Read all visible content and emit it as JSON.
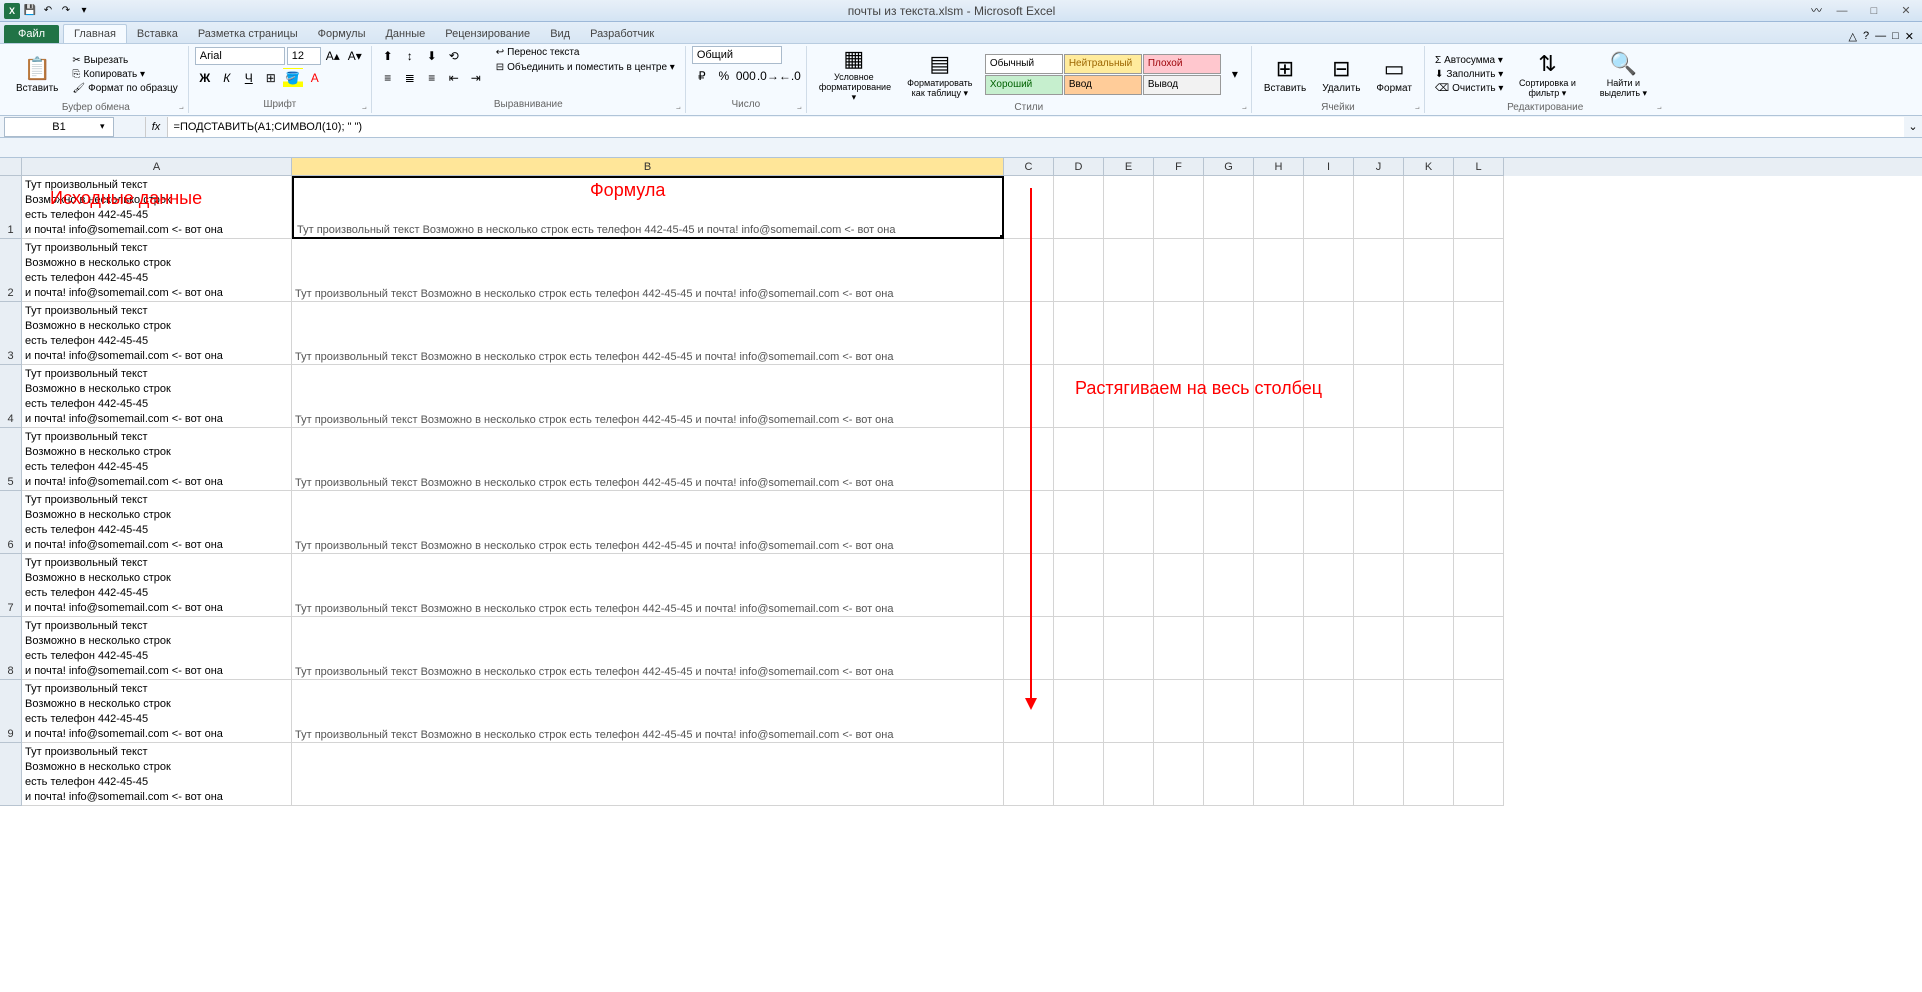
{
  "title": "почты из текста.xlsm - Microsoft Excel",
  "qat": {
    "save": "💾",
    "undo": "↶",
    "redo": "↷"
  },
  "window": {
    "min": "—",
    "max": "□",
    "close": "✕",
    "help": "?",
    "ribmin": "△"
  },
  "tabs": {
    "file": "Файл",
    "items": [
      "Главная",
      "Вставка",
      "Разметка страницы",
      "Формулы",
      "Данные",
      "Рецензирование",
      "Вид",
      "Разработчик"
    ],
    "active": 0
  },
  "ribbon": {
    "clipboard": {
      "paste": "Вставить",
      "cut": "Вырезать",
      "copy": "Копировать ▾",
      "painter": "Формат по образцу",
      "label": "Буфер обмена"
    },
    "font": {
      "name": "Arial",
      "size": "12",
      "label": "Шрифт"
    },
    "align": {
      "wrap": "Перенос текста",
      "merge": "Объединить и поместить в центре ▾",
      "label": "Выравнивание"
    },
    "number": {
      "format": "Общий",
      "label": "Число"
    },
    "styles": {
      "cond": "Условное форматирование ▾",
      "table": "Форматировать как таблицу ▾",
      "normal": "Обычный",
      "neutral": "Нейтральный",
      "bad": "Плохой",
      "good": "Хороший",
      "input": "Ввод",
      "output": "Вывод",
      "label": "Стили"
    },
    "cells": {
      "insert": "Вставить",
      "delete": "Удалить",
      "format": "Формат",
      "label": "Ячейки"
    },
    "editing": {
      "sum": "Автосумма ▾",
      "fill": "Заполнить ▾",
      "clear": "Очистить ▾",
      "sort": "Сортировка и фильтр ▾",
      "find": "Найти и выделить ▾",
      "label": "Редактирование"
    }
  },
  "namebox": "B1",
  "formula": "=ПОДСТАВИТЬ(A1;СИМВОЛ(10); \" \")",
  "columns": [
    "A",
    "B",
    "C",
    "D",
    "E",
    "F",
    "G",
    "H",
    "I",
    "J",
    "K",
    "L"
  ],
  "selected_col": "B",
  "cellA_lines": [
    "Тут произвольный текст",
    "Возможно в несколько строк",
    "есть телефон 442-45-45",
    "и почта! info@somemail.com <- вот она"
  ],
  "cellB_text": "Тут произвольный текст Возможно в несколько строк есть телефон 442-45-45 и почта! info@somemail.com <- вот она",
  "row_count": 9,
  "annotations": {
    "a": "Исходные данные",
    "b": "Формула",
    "c": "Растягиваем на весь столбец"
  }
}
